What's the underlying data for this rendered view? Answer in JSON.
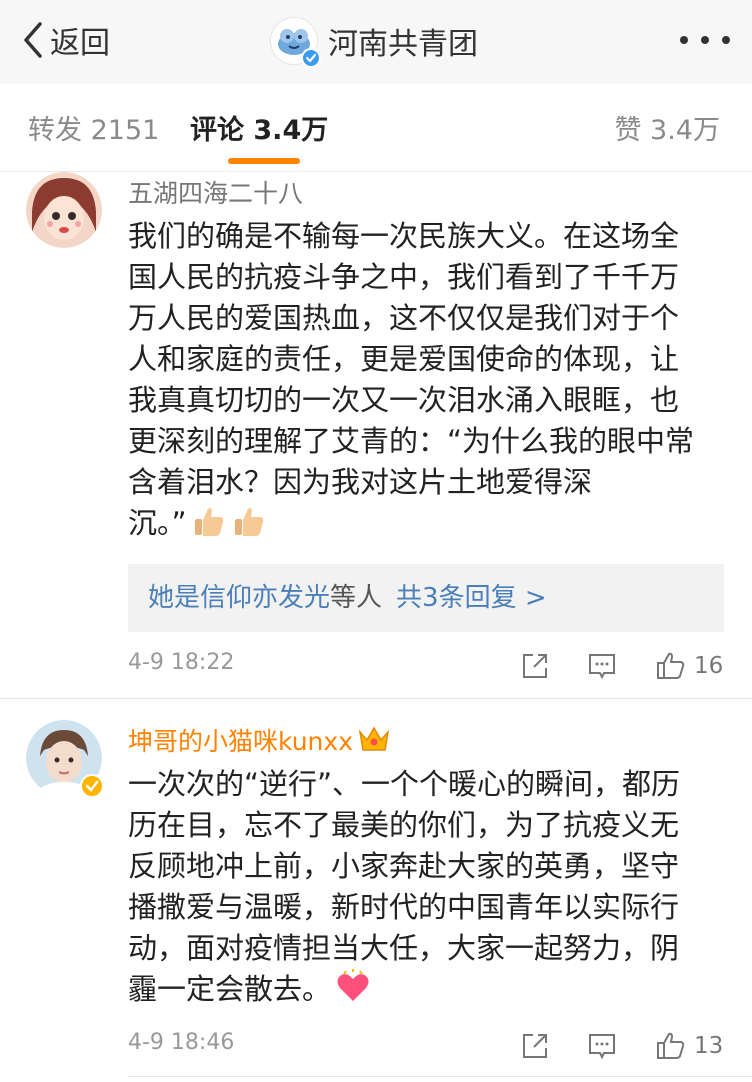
{
  "nav": {
    "back_label": "返回",
    "account_name": "河南共青团",
    "more_icon": "more-dots-icon"
  },
  "tabs": {
    "repost": "转发 2151",
    "comment": "评论 3.4万",
    "like": "赞 3.4万",
    "accent_color": "#ff8200"
  },
  "comments": [
    {
      "username": "五湖四海二十八",
      "lines": [
        "我们的确是不输每一次民族大义。在这场全",
        "国人民的抗疫斗争之中，我们看到了千千万",
        "万人民的爱国热血，这不仅仅是我们对于个",
        "人和家庭的责任，更是爱国使命的体现，让",
        "我真真切切的一次又一次泪水涌入眼眶，也",
        "更深刻的理解了艾青的：“为什么我的眼中常",
        "含着泪水？因为我对这片土地爱得深",
        "沉。”"
      ],
      "emojis": [
        "thumbs-up-emoji",
        "thumbs-up-emoji"
      ],
      "replies": {
        "replier": "她是信仰亦发光",
        "etc": "等人",
        "count_text": "共3条回复 >"
      },
      "time": "4-9 18:22",
      "like_count": "16"
    },
    {
      "username": "坤哥的小猫咪kunxx",
      "lines": [
        "一次次的“逆行”、一个个暖心的瞬间，都历",
        "历在目，忘不了最美的你们，为了抗疫义无",
        "反顾地冲上前，小家奔赴大家的英勇，坚守",
        "播撒爱与温暖，新时代的中国青年以实际行",
        "动，面对疫情担当大任，大家一起努力，阴",
        "霾一定会散去。"
      ],
      "emojis": [
        "heart-emoji"
      ],
      "time": "4-9 18:46",
      "like_count": "13"
    }
  ]
}
